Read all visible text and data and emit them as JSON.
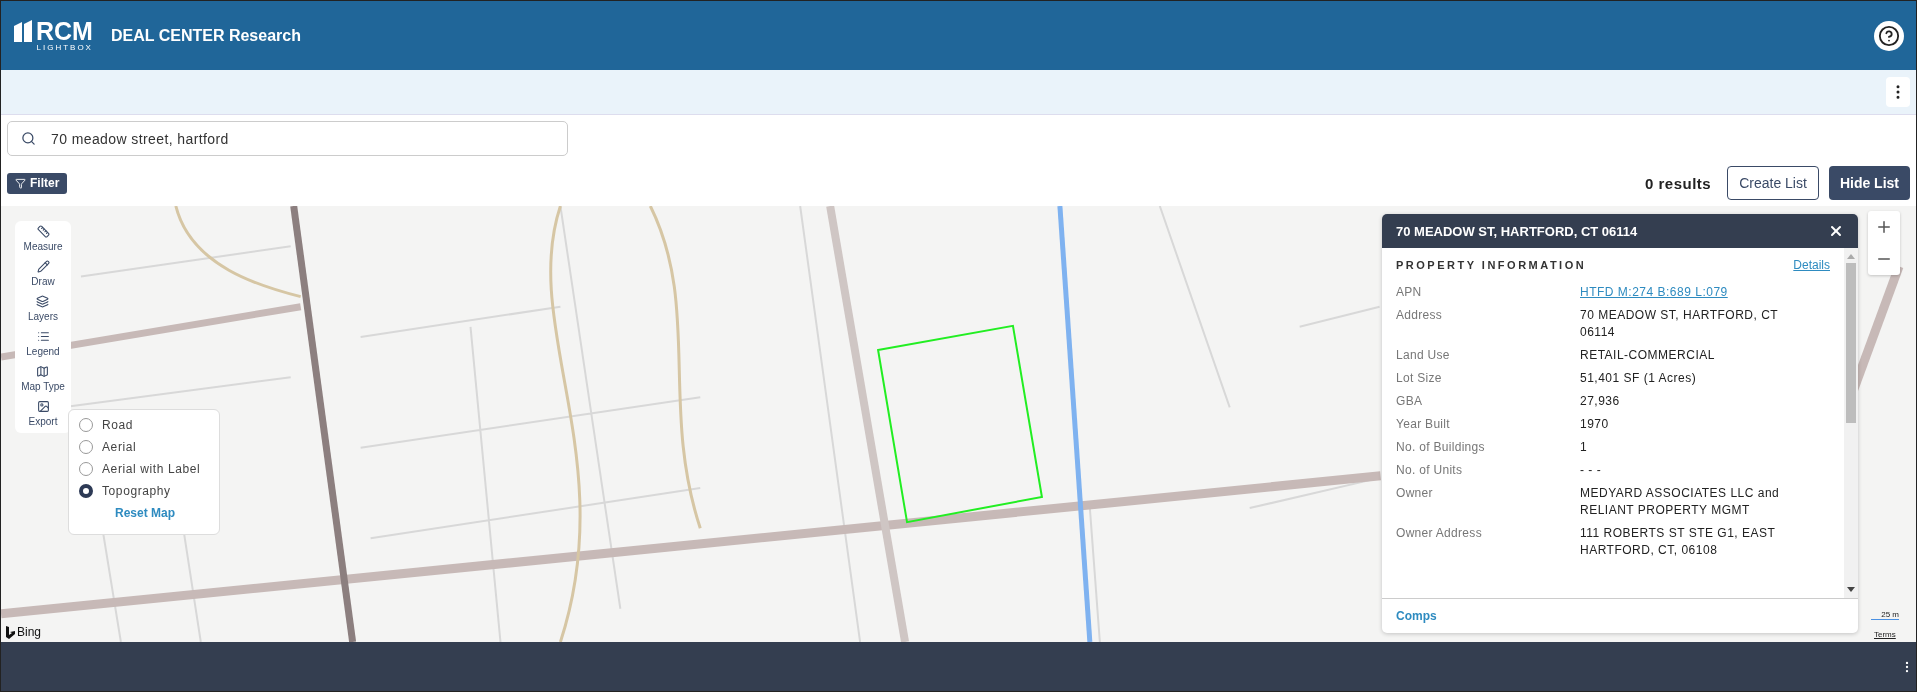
{
  "header": {
    "logo_text": "RCM",
    "logo_subtext": "LIGHTBOX",
    "title": "DEAL CENTER Research"
  },
  "search": {
    "value": "70 meadow street, hartford"
  },
  "toolbar": {
    "filter_label": "Filter",
    "results": "0 results",
    "create_list": "Create List",
    "hide_list": "Hide List"
  },
  "map_tools": [
    {
      "label": "Measure"
    },
    {
      "label": "Draw"
    },
    {
      "label": "Layers"
    },
    {
      "label": "Legend"
    },
    {
      "label": "Map Type"
    },
    {
      "label": "Export"
    }
  ],
  "map_type_menu": {
    "options": [
      {
        "label": "Road",
        "selected": false
      },
      {
        "label": "Aerial",
        "selected": false
      },
      {
        "label": "Aerial with Label",
        "selected": false
      },
      {
        "label": "Topography",
        "selected": true
      }
    ],
    "reset_label": "Reset Map"
  },
  "property_panel": {
    "title": "70 MEADOW ST, HARTFORD, CT 06114",
    "section_title": "PROPERTY INFORMATION",
    "details_link": "Details",
    "fields": [
      {
        "label": "APN",
        "value": "HTFD M:274 B:689 L:079",
        "kind": "link"
      },
      {
        "label": "Address",
        "value": "70 MEADOW ST, HARTFORD, CT 06114",
        "kind": "text"
      },
      {
        "label": "Land Use",
        "value": "RETAIL-COMMERCIAL",
        "kind": "text"
      },
      {
        "label": "Lot Size",
        "value": "51,401 SF (1 Acres)",
        "kind": "text"
      },
      {
        "label": "GBA",
        "value": "27,936",
        "kind": "text"
      },
      {
        "label": "Year Built",
        "value": "1970",
        "kind": "text"
      },
      {
        "label": "No. of Buildings",
        "value": "1",
        "kind": "text"
      },
      {
        "label": "No. of Units",
        "value": "- - -",
        "kind": "text"
      },
      {
        "label": "Owner",
        "value": "MEDYARD ASSOCIATES LLC and RELIANT PROPERTY MGMT",
        "kind": "text"
      },
      {
        "label": "Owner Address",
        "value": "111 ROBERTS ST STE G1, EAST HARTFORD, CT, 06108",
        "kind": "text"
      }
    ],
    "footer_link": "Comps"
  },
  "map_attribution": {
    "provider": "Bing",
    "scale": "25 m",
    "terms": "Terms"
  }
}
